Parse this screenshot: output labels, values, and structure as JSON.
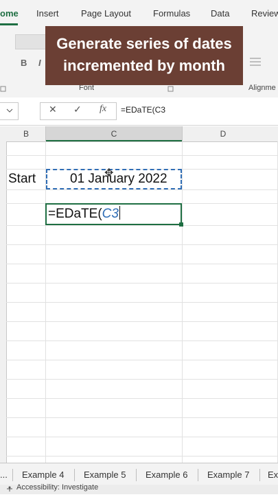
{
  "ribbon_tabs": [
    "ome",
    "Insert",
    "Page Layout",
    "Formulas",
    "Data",
    "Review"
  ],
  "ribbon_groups": {
    "font_label": "Font",
    "alignment_label": "Alignme"
  },
  "ribbon_buttons": {
    "bold": "B",
    "italic": "I"
  },
  "caption": {
    "line1": "Generate series of dates",
    "line2": "incremented by month"
  },
  "formula_bar": {
    "cancel": "✕",
    "confirm": "✓",
    "fx": "fx",
    "formula": "=EDaTE(C3"
  },
  "columns": [
    "B",
    "C",
    "D"
  ],
  "cells": {
    "b3": "Start",
    "c3": "01 January 2022",
    "c4_fn": "=EDaTE(",
    "c4_ref": "C3"
  },
  "sheet_tabs": [
    "...",
    "Example 4",
    "Example 5",
    "Example 6",
    "Example 7",
    "Ex"
  ],
  "status": {
    "accessibility": "Accessibility: Investigate"
  },
  "colors": {
    "accent": "#1e6e42",
    "caption_bg": "#6b3f34",
    "reference_blue": "#2f6db5"
  }
}
